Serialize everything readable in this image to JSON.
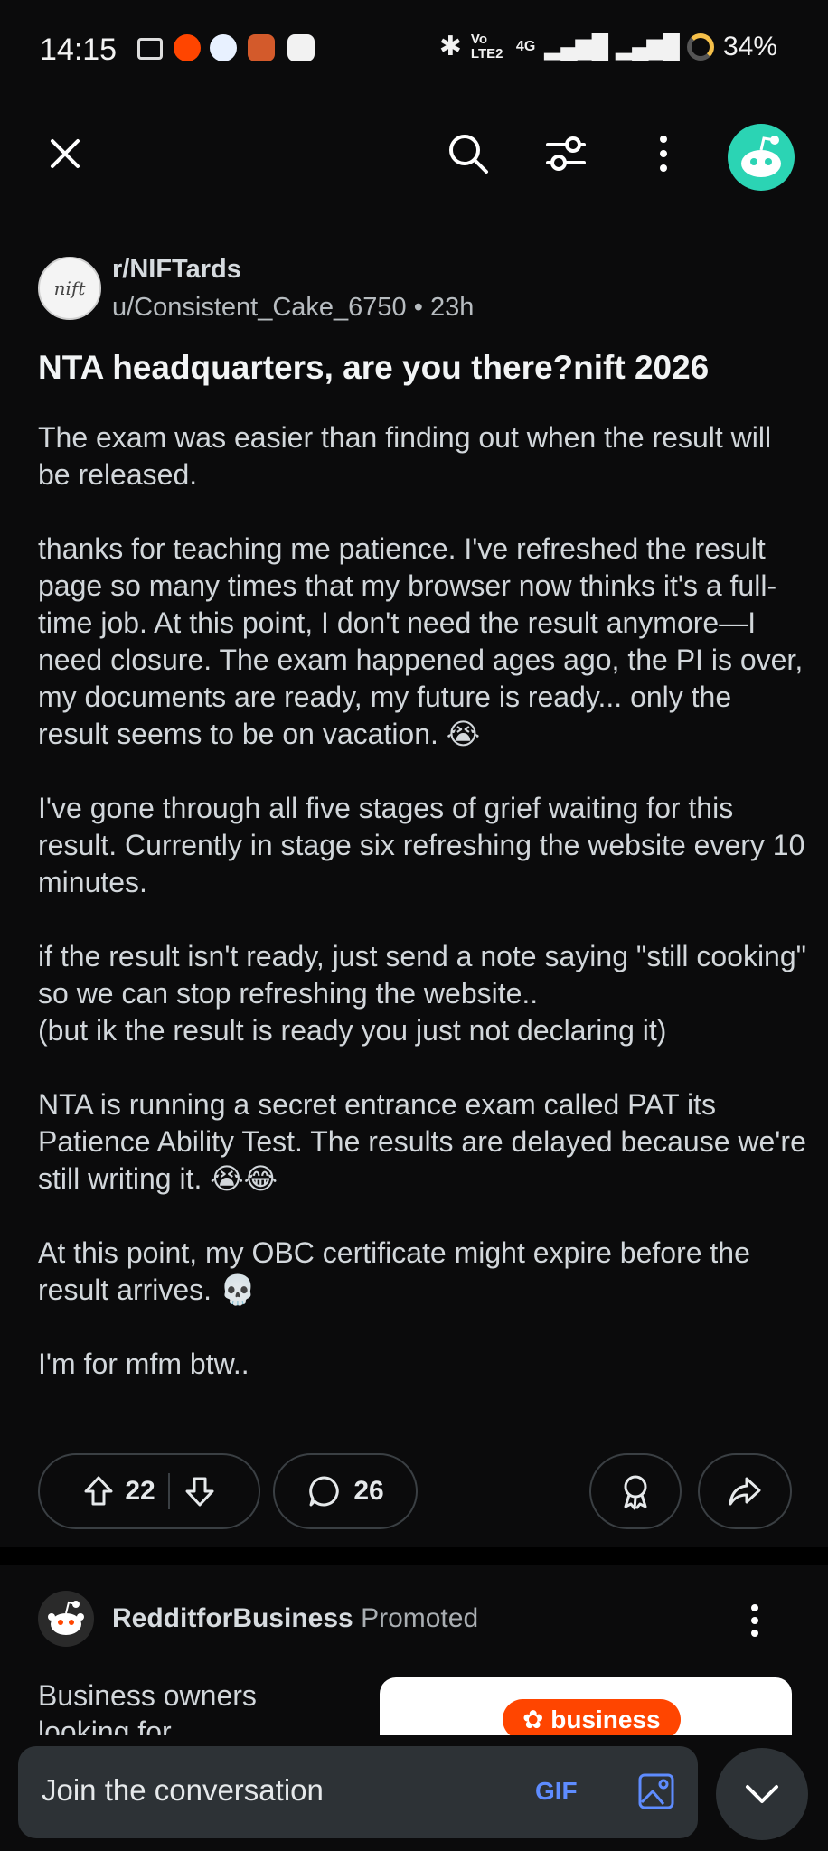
{
  "status_bar": {
    "time": "14:15",
    "volte": "Vo LTE2",
    "network": "4G",
    "battery": "34%"
  },
  "toolbar": {
    "icons": [
      "close-icon",
      "search-icon",
      "filter-icon",
      "more-vertical-icon",
      "avatar"
    ]
  },
  "post": {
    "subreddit": "r/NIFTards",
    "author": "u/Consistent_Cake_6750",
    "age": "23h",
    "title": "NTA headquarters, are you there?nift 2026",
    "paragraphs": [
      "The exam was easier than finding out when the result will be released.",
      "thanks for teaching me patience. I've refreshed the result page so many times that my browser now thinks it's a full-time job. At this point, I don't need the result anymore—I need closure. The exam happened ages ago, the PI is over, my documents are ready, my future is ready... only the result seems to be on vacation. 😭",
      "I've gone through all five stages of grief waiting for this result. Currently in stage six refreshing the website every 10 minutes.",
      "if the result isn't ready, just send a note saying \"still cooking\" so we can stop refreshing the website..\n(but ik the result is ready you just not declaring it)",
      "NTA is running a secret entrance exam called PAT its Patience Ability Test. The results are delayed because we're still writing it. 😭😂",
      "At this point, my OBC certificate might expire before the result arrives. 💀",
      "I'm for mfm btw.."
    ],
    "upvotes": "22",
    "comments": "26"
  },
  "promoted": {
    "name": "RedditforBusiness",
    "tag": "Promoted",
    "text": "Business owners looking for",
    "badge": "business"
  },
  "composer": {
    "placeholder": "Join the conversation",
    "gif_label": "GIF"
  },
  "colors": {
    "background": "#0b0b0c",
    "avatar": "#2bd4b4",
    "gif": "#5e8cff",
    "brand": "#ff4500"
  }
}
